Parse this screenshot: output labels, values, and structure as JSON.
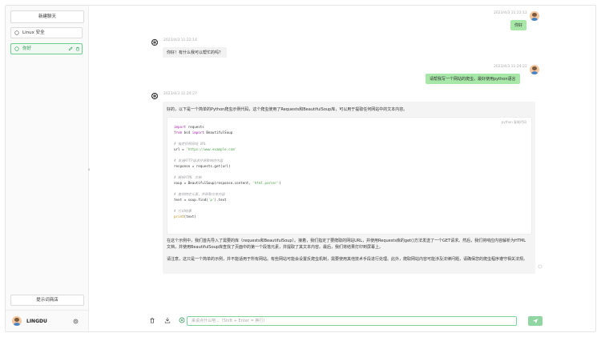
{
  "sidebar": {
    "new_chat": "新建聊天",
    "conversations": [
      {
        "label": "Linux 安全"
      },
      {
        "label": "你好"
      }
    ],
    "prompt_store": "提示词商店",
    "user_name": "LINGDU"
  },
  "messages": {
    "m1_time": "2023/4/3 11:22:12",
    "m1_text": "你好",
    "m2_time": "2023/4/3 11:22:14",
    "m2_text": "你好！有什么我可以帮忙的吗？",
    "m3_time": "2023/4/3 11:24:22",
    "m3_text": "请帮我写一个网站的爬虫，最好使用python语言",
    "m4_time": "2023/4/3 11:24:27",
    "m4_intro": "好的，以下是一个简单的Python爬虫示例代码，这个爬虫使用了Requests和BeautifulSoup库，可以用于提取任何网站中的文本内容。",
    "code_lang": "python  复制代码",
    "code": {
      "l1a": "import",
      "l1b": " requests",
      "l2a": "from",
      "l2b": " bs4 ",
      "l2c": "import",
      "l2d": " BeautifulSoup",
      "l3": "# 指定目标网站 URL",
      "l4a": "url = ",
      "l4b": "'https://www.example.com'",
      "l5": "# 发送HTTP请求并获取响应内容",
      "l6": "response = requests.get(url)",
      "l7": "# 解析HTML 文档",
      "l8a": "soup = BeautifulSoup(response.content, ",
      "l8b": "'html.parser'",
      "l8c": ")",
      "l9": "# 查找特定元素，并获取文本内容",
      "l10a": "text = soup.find(",
      "l10b": "'p'",
      "l10c": ").text",
      "l11": "# 打印结果",
      "l12a": "print",
      "l12b": "(text)"
    },
    "m4_p1": "在这个示例中，我们首先导入了需要的库（requests和BeautifulSoup）。接着，我们指定了要爬取的网站URL，并使用Requests库的get()方法发送了一个GET请求。然后，我们将响应内容解析为HTML文档，并使用BeautifulSoup库查找了页面中的第一个段落元素，并提取了其文本内容。最后，我们将结果打印到屏幕上。",
    "m4_p2": "请注意，这只是一个简单的示例，并不能适用于所有网站。有些网站可能会设置反爬虫机制，需要使用其他技术手段进行处理。此外，爬取网站内容可能涉及法律问题，请确保您的爬虫程序遵守相关法规。"
  },
  "input": {
    "placeholder": "来说点什么吧...（Shift + Enter = 换行）"
  },
  "colors": {
    "accent": "#6ccf8f",
    "user_bubble": "#a7e7a7"
  }
}
